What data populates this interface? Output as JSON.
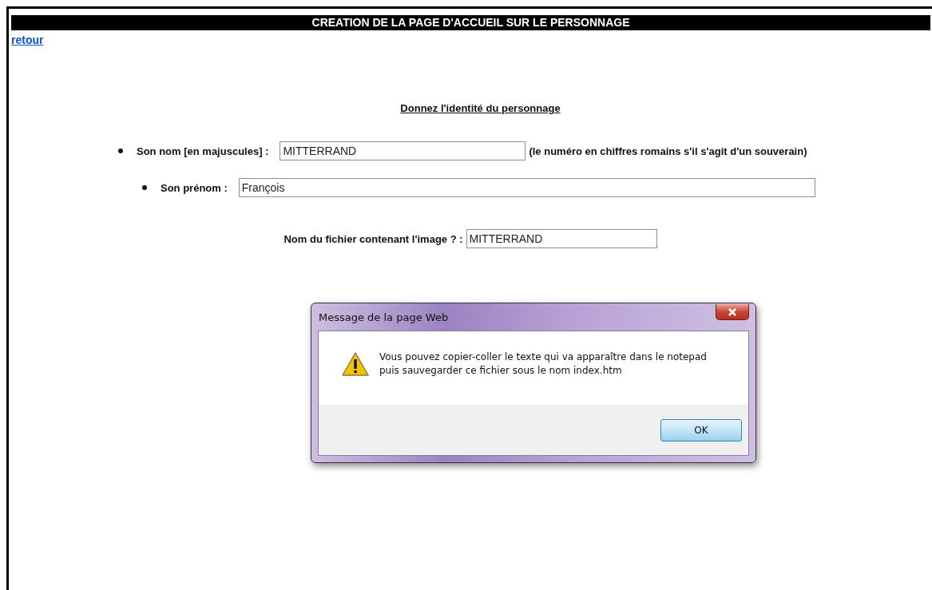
{
  "page": {
    "title": "CREATION DE LA PAGE D'ACCUEIL SUR LE PERSONNAGE",
    "back_link": "retour",
    "heading": "Donnez l'identité du personnage"
  },
  "fields": [
    {
      "label": "Son nom [en majuscules] :",
      "value": "MITTERRAND",
      "note": "(le numéro en chiffres romains s'il s'agit d'un souverain)",
      "children": [
        {
          "label": "Son prénom :",
          "value": "François"
        }
      ]
    }
  ],
  "file_field": {
    "label": "Nom du fichier contenant l'image ? :",
    "value": "MITTERRAND"
  },
  "dialog": {
    "title": "Message de la page Web",
    "message": "Vous pouvez copier-coller le texte qui va apparaître dans le notepad\npuis sauvegarder ce fichier sous le nom index.htm",
    "buttons": [
      "OK"
    ]
  }
}
